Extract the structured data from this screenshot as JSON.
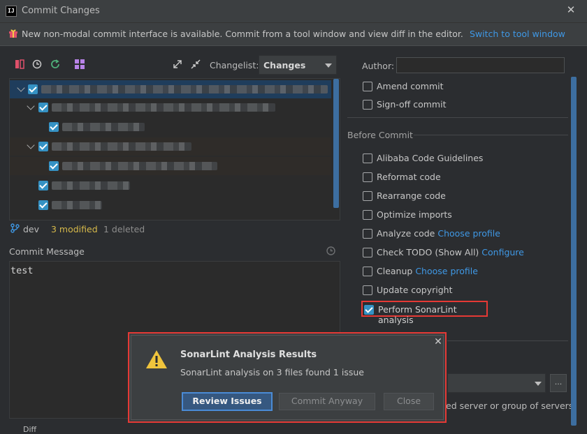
{
  "window": {
    "title": "Commit Changes",
    "logo_text": "IJ"
  },
  "banner": {
    "text": "New non-modal commit interface is available. Commit from a tool window and view diff in the editor.",
    "link": "Switch to tool window"
  },
  "toolbar": {
    "changelist_label": "Changelist:",
    "changelist_value": "Changes"
  },
  "branch": {
    "name": "dev",
    "modified": "3 modified",
    "deleted": "1 deleted"
  },
  "commit_message": {
    "label": "Commit Message",
    "value": "test"
  },
  "diff_label": "Diff",
  "author": {
    "label": "Author:",
    "value": ""
  },
  "options_top": [
    {
      "label": "Amend commit",
      "checked": false
    },
    {
      "label": "Sign-off commit",
      "checked": false
    }
  ],
  "before_commit": {
    "heading": "Before Commit",
    "items": [
      {
        "label": "Alibaba Code Guidelines",
        "link": "",
        "checked": false
      },
      {
        "label": "Reformat code",
        "link": "",
        "checked": false
      },
      {
        "label": "Rearrange code",
        "link": "",
        "checked": false
      },
      {
        "label": "Optimize imports",
        "link": "",
        "checked": false
      },
      {
        "label": "Analyze code",
        "link": "Choose profile",
        "checked": false
      },
      {
        "label": "Check TODO (Show All)",
        "link": "Configure",
        "checked": false
      },
      {
        "label": "Cleanup",
        "link": "Choose profile",
        "checked": false
      },
      {
        "label": "Update copyright",
        "link": "",
        "checked": false
      }
    ],
    "sonarlint": {
      "label": "Perform SonarLint analysis",
      "checked": true
    }
  },
  "server": {
    "more_label": "...",
    "text": "ed server or group of servers"
  },
  "popup": {
    "title": "SonarLint Analysis Results",
    "message": "SonarLint analysis on 3 files found 1 issue",
    "review_label": "Review Issues",
    "commit_anyway_label": "Commit Anyway",
    "close_label": "Close"
  },
  "colors": {
    "accent": "#3592c4",
    "link": "#3f98e5",
    "highlight": "#e53935",
    "modified": "#d6b94a"
  },
  "icons": [
    "gift-icon",
    "close-icon",
    "warning-icon",
    "branch-icon",
    "history-icon",
    "expand-icon",
    "collapse-icon",
    "refresh-icon",
    "rollback-icon",
    "diff-icon",
    "group-icon"
  ]
}
